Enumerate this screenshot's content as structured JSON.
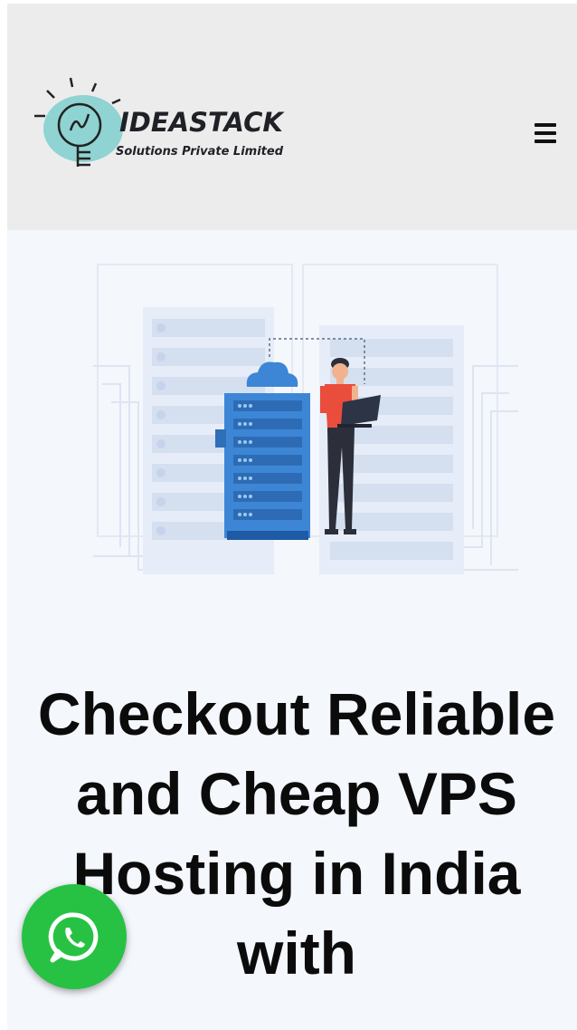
{
  "header": {
    "logo": {
      "title": "IDEASTACK",
      "subtitle": "Solutions Private Limited"
    },
    "menu_icon": "hamburger-menu-icon"
  },
  "hero": {
    "illustration_icon": "server-hosting-illustration",
    "headline": "Checkout Reliable and Cheap VPS Hosting in India with"
  },
  "floating": {
    "whatsapp_icon": "whatsapp-icon"
  },
  "colors": {
    "header_bg": "#ececec",
    "hero_bg": "#f4f7fc",
    "logo_teal": "#8fd3d3",
    "server_blue": "#3d86d6",
    "whatsapp_green": "#27c243",
    "shirt_red": "#ea4d3c"
  }
}
